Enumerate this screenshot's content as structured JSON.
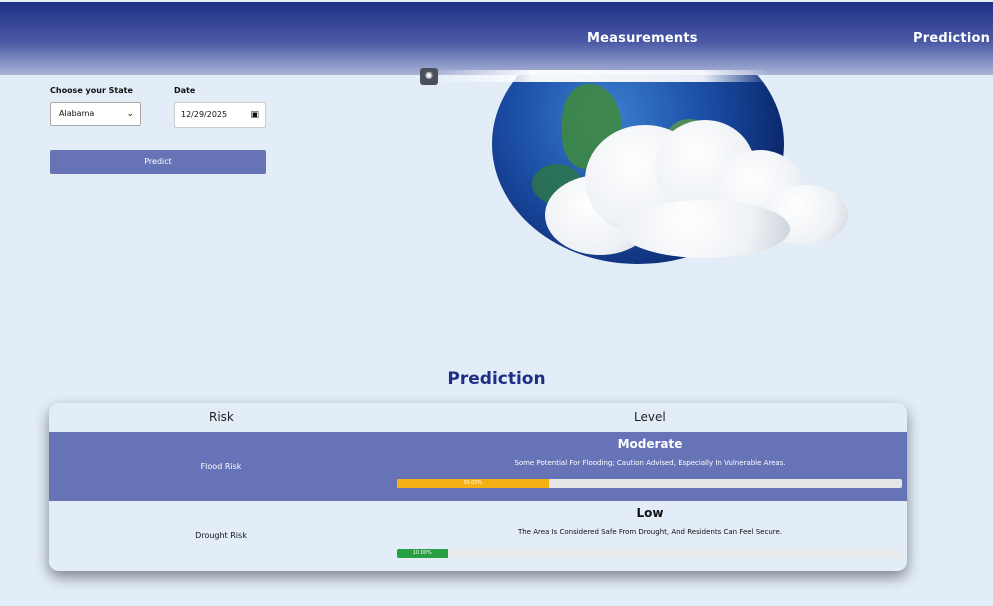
{
  "nav": {
    "measurements_label": "Measurements",
    "prediction_label": "Prediction"
  },
  "form": {
    "state_label": "Choose your State",
    "state_value": "Alabama",
    "date_label": "Date",
    "date_value": "12/29/2025",
    "predict_button": "Predict"
  },
  "prediction": {
    "title": "Prediction",
    "columns": [
      "Risk",
      "Level"
    ],
    "rows": [
      {
        "risk": "Flood Risk",
        "level": "Moderate",
        "description": "Some Potential For Flooding; Caution Advised, Especially In Vulnerable Areas.",
        "percent_label": "30.00%",
        "percent": 30,
        "bar_color": "#f5b014"
      },
      {
        "risk": "Drought Risk",
        "level": "Low",
        "description": "The Area Is Considered Safe From Drought, And Residents Can Feel Secure.",
        "percent_label": "10.00%",
        "percent": 10,
        "bar_color": "#27a043"
      }
    ]
  },
  "colors": {
    "header": "#1f2f86",
    "accent": "#6673b7",
    "background": "#e3edf8"
  }
}
